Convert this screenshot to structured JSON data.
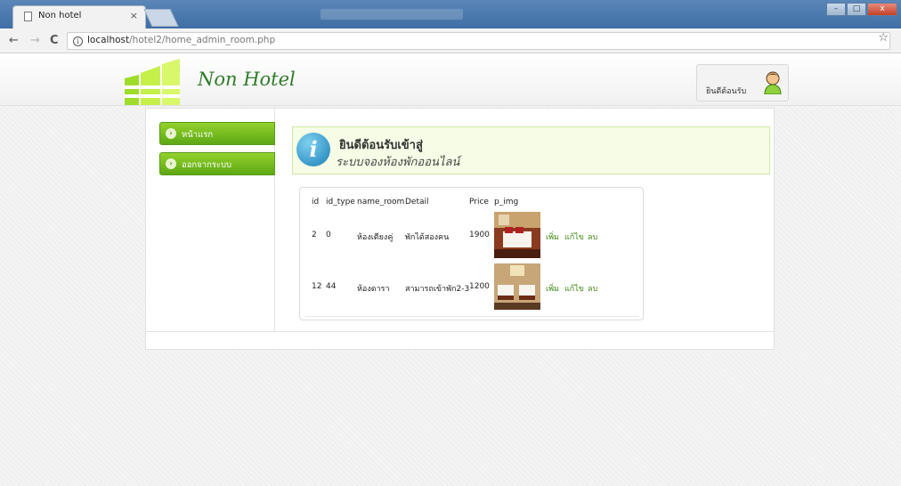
{
  "browser": {
    "tab_title": "Non hotel",
    "tab_close": "×",
    "url_host": "localhost",
    "url_path": "/hotel2/home_admin_room.php",
    "back_icon": "←",
    "forward_icon": "→",
    "reload_icon": "C",
    "info_icon": "i",
    "star_icon": "☆",
    "window_minimize": "–",
    "window_maximize": "□",
    "window_close": "x"
  },
  "header": {
    "logo_text": "Non Hotel",
    "welcome_text": "ยินดีต้อนรับ"
  },
  "menu": [
    {
      "label": "หน้าแรก",
      "icon": "arrow-right-icon"
    },
    {
      "label": "ออกจากระบบ",
      "icon": "arrow-right-icon"
    }
  ],
  "banner": {
    "badge": "i",
    "title": "ยินดีต้อนรับเข้าสู่",
    "subtitle": "ระบบจองห้องพักออนไลน์"
  },
  "table": {
    "headers": [
      "id",
      "id_type",
      "name_room",
      "Detail",
      "Price",
      "p_img"
    ],
    "rows": [
      {
        "id": "2",
        "id_type": "0",
        "name_room": "ห้องเตียงคู่",
        "detail": "พักได้สองคน",
        "price": "1900",
        "add": "เพิ่ม",
        "edit": "แก้ไข",
        "delete": "ลบ"
      },
      {
        "id": "12",
        "id_type": "44",
        "name_room": "ห้องดารา",
        "detail": "สามารถเข้าพัก2-3",
        "price": "1200",
        "add": "เพิ่ม",
        "edit": "แก้ไข",
        "delete": "ลบ"
      }
    ]
  },
  "colors": {
    "menu_green": "#6cb81a",
    "logo_green": "#2e7c28",
    "link_green": "#3d8a12",
    "banner_bg": "#f6fce6"
  }
}
